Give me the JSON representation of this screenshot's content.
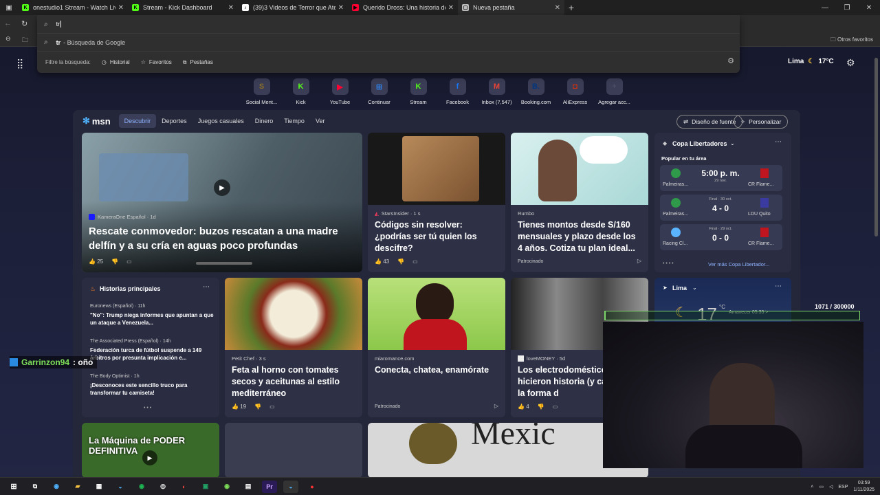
{
  "tabs": [
    {
      "title": "onestudio1 Stream - Watch Live ...",
      "color": "#53fc18",
      "glyph": "K"
    },
    {
      "title": "Stream - Kick Dashboard",
      "color": "#53fc18",
      "glyph": "K"
    },
    {
      "title": "(39)3 Videos de Terror que Aterra...",
      "color": "#ffffff",
      "glyph": "♪"
    },
    {
      "title": "Querido Dross: Una historia de H...",
      "color": "#ff0033",
      "glyph": "▶"
    },
    {
      "title": "Nueva pestaña",
      "color": "#bbbbbb",
      "glyph": "▢"
    }
  ],
  "omnibox": {
    "value": "tr",
    "suggestion_query": "tr",
    "suggestion_text": "- Búsqueda de Google",
    "filter_label": "Filtre la búsqueda:",
    "filters": [
      "Historial",
      "Favoritos",
      "Pestañas"
    ]
  },
  "favorites_bar": {
    "other": "Otros favoritos"
  },
  "weather_top": {
    "city": "Lima",
    "temp": "17°C"
  },
  "quicklinks": [
    {
      "label": "Social Ment...",
      "glyph": "S",
      "color": "#8a6d2a"
    },
    {
      "label": "Kick",
      "glyph": "K",
      "color": "#53fc18"
    },
    {
      "label": "YouTube",
      "glyph": "▶",
      "color": "#ff0033"
    },
    {
      "label": "Continuar",
      "glyph": "⊞",
      "color": "#2f7de1"
    },
    {
      "label": "Stream",
      "glyph": "K",
      "color": "#53fc18"
    },
    {
      "label": "Facebook",
      "glyph": "f",
      "color": "#1877f2"
    },
    {
      "label": "Inbox (7,547)",
      "glyph": "M",
      "color": "#ea4335"
    },
    {
      "label": "Booking.com",
      "glyph": "B.",
      "color": "#003580"
    },
    {
      "label": "AliExpress",
      "glyph": "◘",
      "color": "#e62e04"
    },
    {
      "label": "Agregar acc...",
      "glyph": "+",
      "color": "#4a4d66"
    }
  ],
  "feed": {
    "logo": "msn",
    "nav": [
      "Descubrir",
      "Deportes",
      "Juegos casuales",
      "Dinero",
      "Tiempo",
      "Ver"
    ],
    "font_button": "Diseño de fuente",
    "personalize_button": "Personalizar",
    "hero": {
      "source": "KameraOne Español · 1d",
      "title": "Rescate conmovedor: buzos rescatan a una madre delfín y a su cría en aguas poco profundas",
      "likes": "25"
    },
    "card2": {
      "source": "StarsInsider · 1 s",
      "title": "Códigos sin resolver: ¿podrías ser tú quien los descifre?",
      "likes": "43"
    },
    "card3": {
      "source": "Rumbo",
      "title": "Tienes montos desde S/160 mensuales y plazo desde los 4 años. Cotiza tu plan ideal...",
      "sponsored": "Patrocinado"
    },
    "sports": {
      "title": "Copa Libertadores",
      "subtitle": "Popular en tu área",
      "more": "Ver más Copa Libertador...",
      "matches": [
        {
          "home": "Palmeiras...",
          "away": "CR Flame...",
          "center": "5:00 p. m.",
          "sub": "29 nov."
        },
        {
          "home": "Palmeiras...",
          "away": "LDU Quito",
          "center": "4 - 0",
          "sub": "Final · 30 oct."
        },
        {
          "home": "Racing Cl...",
          "away": "CR Flame...",
          "center": "0 - 0",
          "sub": "Final · 29 oct."
        }
      ]
    },
    "stories": {
      "title": "Historias principales",
      "items": [
        {
          "source": "Euronews (Español) · 11h",
          "title": "\"No\": Trump niega informes que apuntan a que un ataque a Venezuela..."
        },
        {
          "source": "The Associated Press (Español) · 14h",
          "title": "Federación turca de fútbol suspende a 149 árbitros por presunta implicación e..."
        },
        {
          "source": "The Body Optimist · 1h",
          "title": "¡Desconoces este sencillo truco para transformar tu camiseta!"
        }
      ]
    },
    "card5": {
      "source": "Petit Chef · 3 s",
      "title": "Feta al horno con tomates secos y aceitunas al estilo mediterráneo",
      "likes": "19"
    },
    "card6": {
      "source": "miaromance.com",
      "title": "Conecta, chatea, enamórate",
      "sponsored": "Patrocinado"
    },
    "card7": {
      "source": "loveMONEY · 5d",
      "title": "Los electrodomésticos que hicieron historia (y cambiaron la forma d",
      "likes": "4"
    },
    "weather": {
      "city": "Lima",
      "temp": "17",
      "unit": "°C",
      "sunrise": "Amanecer 05:35 >"
    },
    "bottom": {
      "thumb_text": "La Máquina de PODER DEFINITIVA",
      "mexico_text": "Mexic"
    }
  },
  "overlay": {
    "chat_user": "Garrinzon94",
    "chat_msg": ": oño",
    "progress": "1071 / 300000",
    "progress_value": 0.00357
  },
  "taskbar": {
    "lang": "ESP",
    "time": "03:59",
    "date": "1/11/2025"
  }
}
